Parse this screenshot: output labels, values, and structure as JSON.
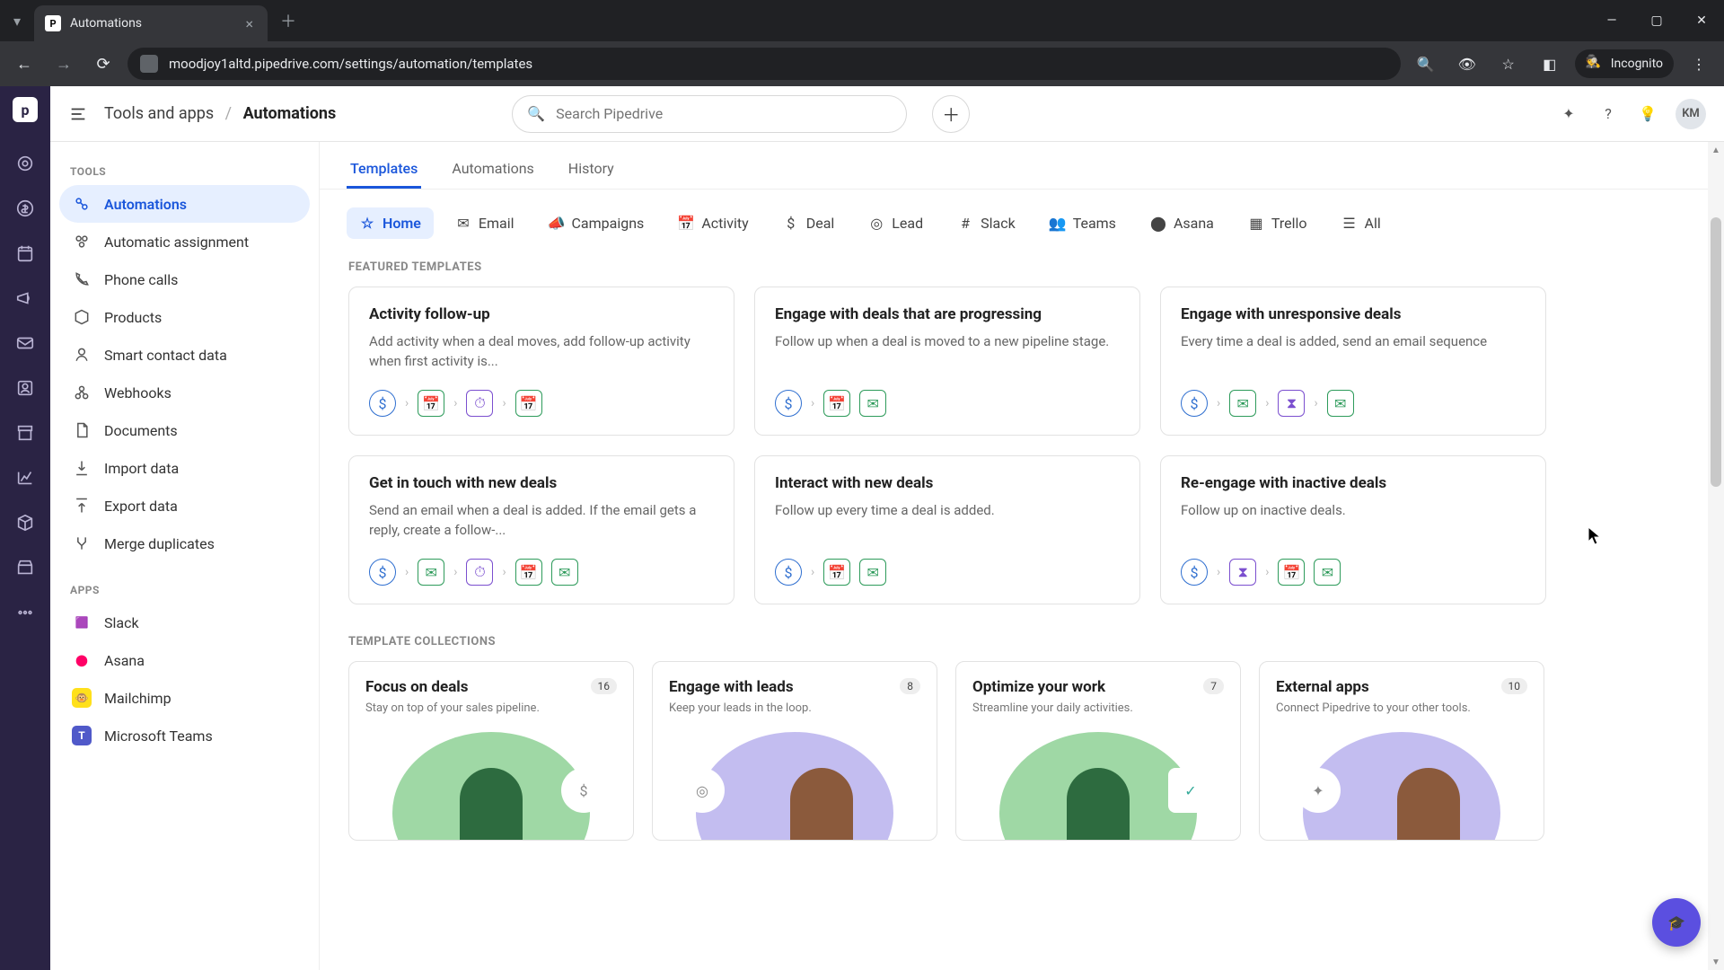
{
  "browser": {
    "tab_title": "Automations",
    "favicon_letter": "P",
    "url": "moodjoy1altd.pipedrive.com/settings/automation/templates",
    "incognito_label": "Incognito"
  },
  "header": {
    "breadcrumb_root": "Tools and apps",
    "breadcrumb_current": "Automations",
    "search_placeholder": "Search Pipedrive",
    "avatar_initials": "KM"
  },
  "sidebar": {
    "section_tools": "TOOLS",
    "tools": [
      {
        "label": "Automations"
      },
      {
        "label": "Automatic assignment"
      },
      {
        "label": "Phone calls"
      },
      {
        "label": "Products"
      },
      {
        "label": "Smart contact data"
      },
      {
        "label": "Webhooks"
      },
      {
        "label": "Documents"
      },
      {
        "label": "Import data"
      },
      {
        "label": "Export data"
      },
      {
        "label": "Merge duplicates"
      }
    ],
    "section_apps": "APPS",
    "apps": [
      {
        "label": "Slack"
      },
      {
        "label": "Asana"
      },
      {
        "label": "Mailchimp"
      },
      {
        "label": "Microsoft Teams"
      }
    ]
  },
  "tabs": [
    {
      "label": "Templates"
    },
    {
      "label": "Automations"
    },
    {
      "label": "History"
    }
  ],
  "filters": [
    {
      "label": "Home"
    },
    {
      "label": "Email"
    },
    {
      "label": "Campaigns"
    },
    {
      "label": "Activity"
    },
    {
      "label": "Deal"
    },
    {
      "label": "Lead"
    },
    {
      "label": "Slack"
    },
    {
      "label": "Teams"
    },
    {
      "label": "Asana"
    },
    {
      "label": "Trello"
    },
    {
      "label": "All"
    }
  ],
  "featured_header": "FEATURED TEMPLATES",
  "featured": [
    {
      "title": "Activity follow-up",
      "desc": "Add activity when a deal moves, add follow-up activity when first activity is..."
    },
    {
      "title": "Engage with deals that are progressing",
      "desc": "Follow up when a deal is moved to a new pipeline stage."
    },
    {
      "title": "Engage with unresponsive deals",
      "desc": "Every time a deal is added, send an email sequence"
    },
    {
      "title": "Get in touch with new deals",
      "desc": "Send an email when a deal is added. If the email gets a reply, create a follow-..."
    },
    {
      "title": "Interact with new deals",
      "desc": "Follow up every time a deal is added."
    },
    {
      "title": "Re-engage with inactive deals",
      "desc": "Follow up on inactive deals."
    }
  ],
  "collections_header": "TEMPLATE COLLECTIONS",
  "collections": [
    {
      "title": "Focus on deals",
      "count": "16",
      "sub": "Stay on top of your sales pipeline."
    },
    {
      "title": "Engage with leads",
      "count": "8",
      "sub": "Keep your leads in the loop."
    },
    {
      "title": "Optimize your work",
      "count": "7",
      "sub": "Streamline your daily activities."
    },
    {
      "title": "External apps",
      "count": "10",
      "sub": "Connect Pipedrive to your other tools."
    }
  ]
}
